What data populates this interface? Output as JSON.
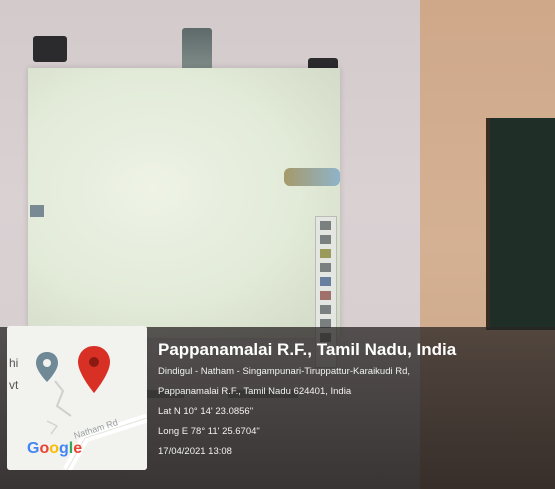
{
  "location": {
    "title": "Pappanamalai R.F., Tamil Nadu, India",
    "road": "Dindigul - Natham - Singampunari-Tiruppattur-Karaikudi Rd,",
    "address": "Pappanamalai R.F., Tamil Nadu 624401, India",
    "latitude": "Lat N 10° 14' 23.0856\"",
    "longitude": "Long E 78° 11' 25.6704\"",
    "datetime": "17/04/2021 13:08"
  },
  "map": {
    "brand": "Google",
    "road_label": "Natham Rd",
    "frag_top": "hi",
    "frag_bottom": "vt",
    "pin_color": "#d93025",
    "gray_pin_color": "#6f8a96"
  },
  "colors": {
    "overlay": "#2a2525",
    "google_blue": "#4285F4",
    "google_red": "#EA4335",
    "google_yellow": "#FBBC05",
    "google_green": "#34A853"
  }
}
